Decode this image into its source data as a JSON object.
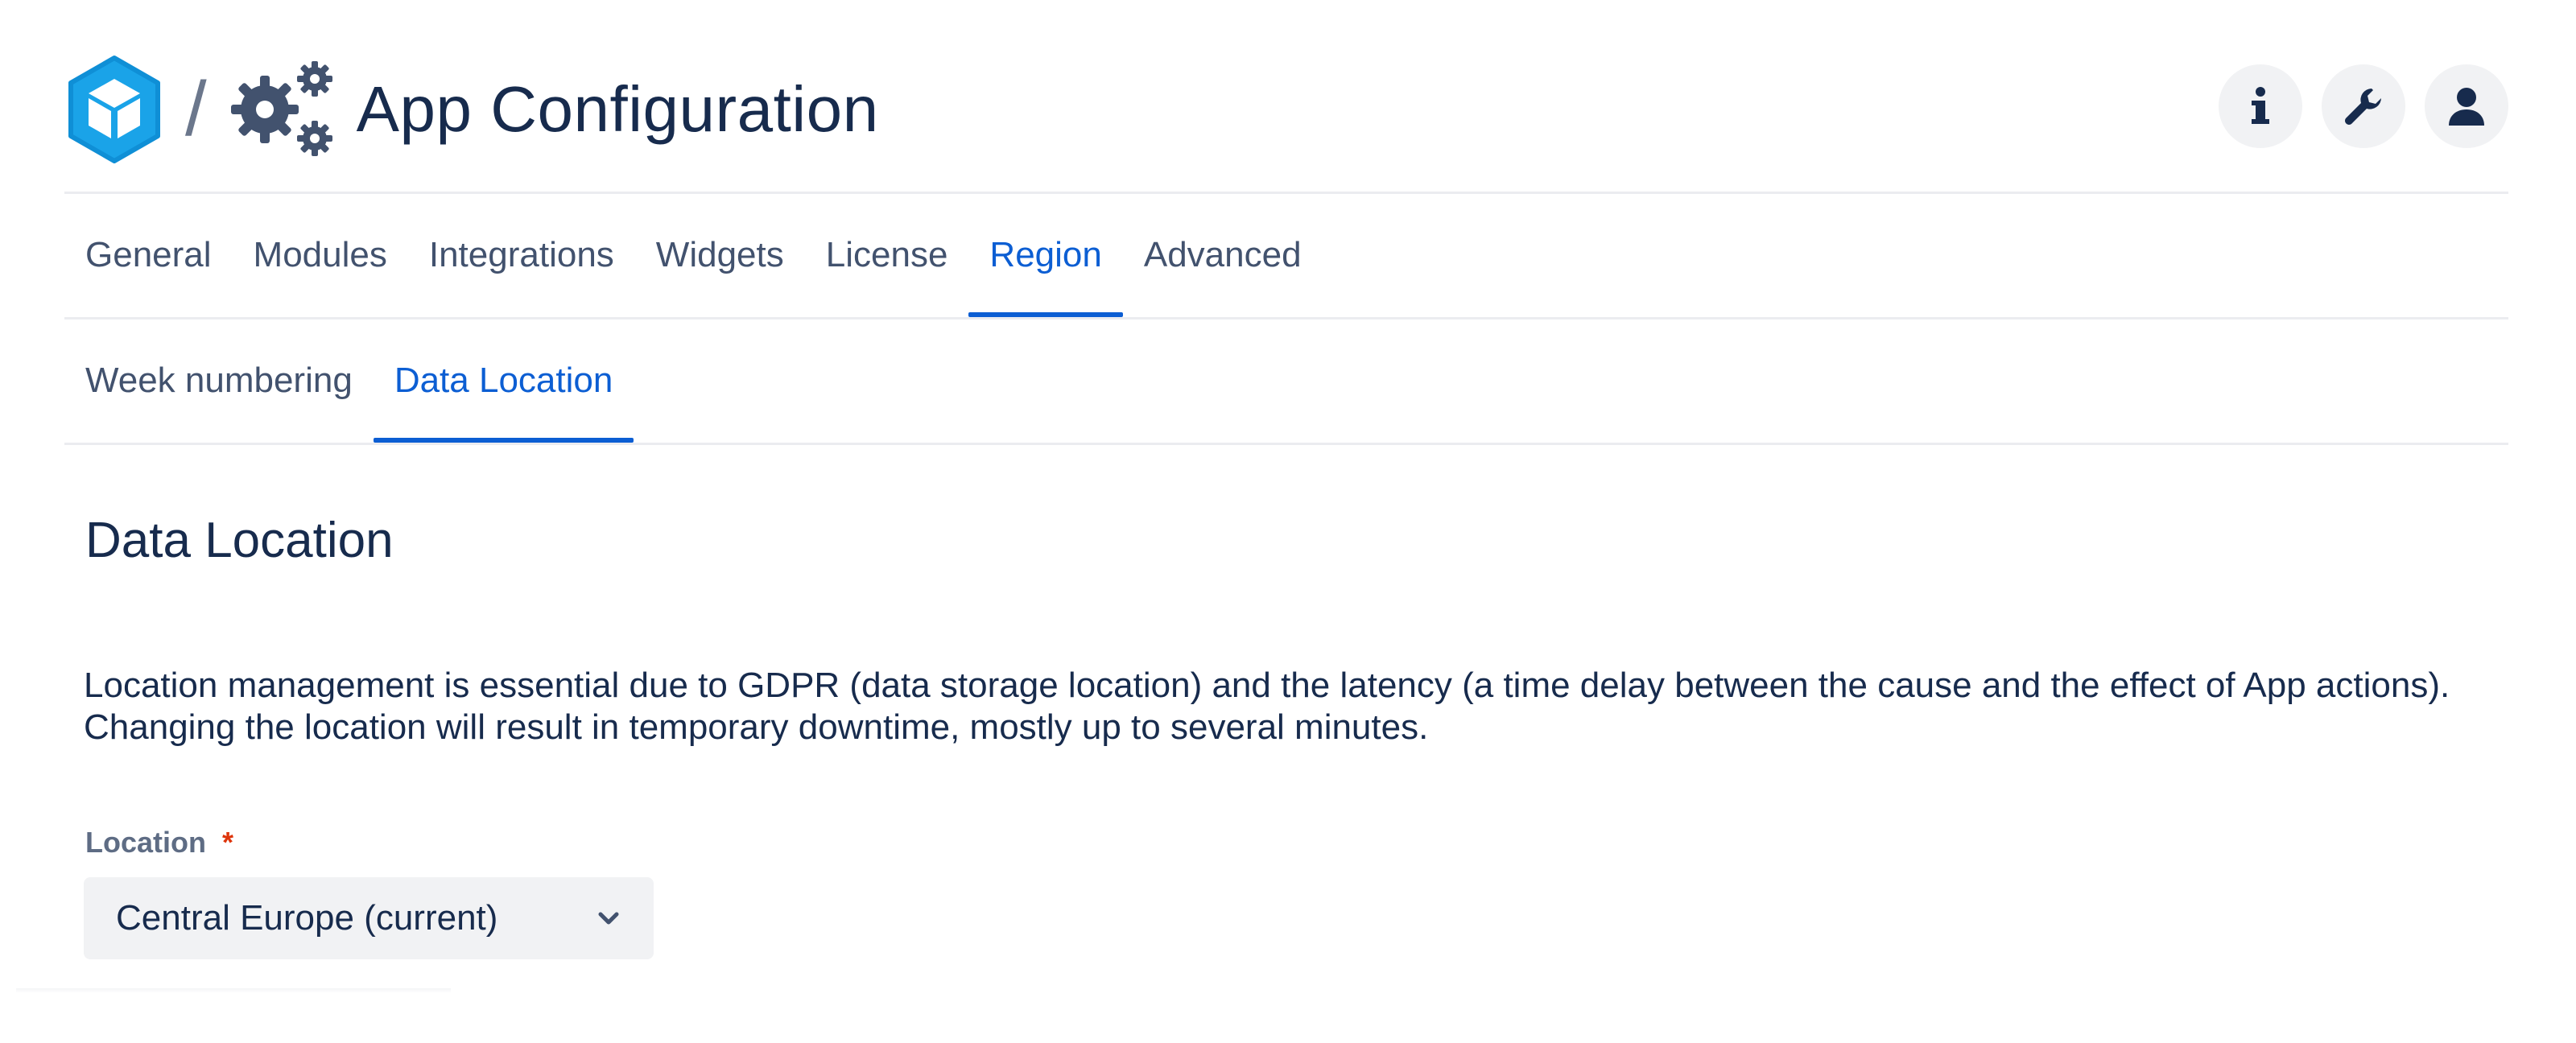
{
  "header": {
    "separator": "/",
    "title": "App Configuration",
    "icons": {
      "logo": "app-logo-icon",
      "gears": "gears-icon",
      "info": "info-icon",
      "tools": "wrench-icon",
      "user": "user-icon"
    }
  },
  "tabs": [
    {
      "label": "General",
      "active": false
    },
    {
      "label": "Modules",
      "active": false
    },
    {
      "label": "Integrations",
      "active": false
    },
    {
      "label": "Widgets",
      "active": false
    },
    {
      "label": "License",
      "active": false
    },
    {
      "label": "Region",
      "active": true
    },
    {
      "label": "Advanced",
      "active": false
    }
  ],
  "subtabs": [
    {
      "label": "Week numbering",
      "active": false
    },
    {
      "label": "Data Location",
      "active": true
    }
  ],
  "content": {
    "title": "Data Location",
    "description_line1": "Location management is essential due to GDPR (data storage location) and the latency (a time delay between the cause and the effect of App actions).",
    "description_line2": "Changing the location will result in temporary downtime, mostly up to several minutes.",
    "location_label": "Location",
    "required_marker": "*",
    "location_value": "Central Europe (current)"
  },
  "colors": {
    "accent": "#0c5ed3",
    "text": "#172b4d",
    "muted": "#42526e",
    "required": "#de350b",
    "logo_blue": "#1aa3e8"
  }
}
